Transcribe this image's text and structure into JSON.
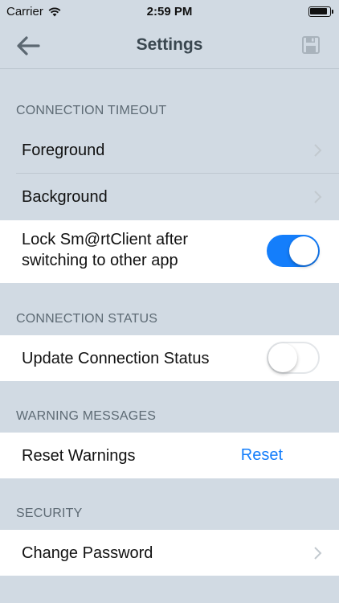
{
  "status_bar": {
    "carrier": "Carrier",
    "time": "2:59 PM"
  },
  "nav": {
    "title": "Settings",
    "back_icon": "arrow-left-icon",
    "save_icon": "floppy-disk-icon"
  },
  "sections": {
    "timeout": {
      "header": "CONNECTION TIMEOUT",
      "foreground": "Foreground",
      "background": "Background",
      "lock_line1": "Lock Sm@rtClient after",
      "lock_line2": "switching to other app",
      "lock_toggle_on": true
    },
    "status": {
      "header": "CONNECTION STATUS",
      "update": "Update Connection Status",
      "update_toggle_on": false
    },
    "warnings": {
      "header": "WARNING MESSAGES",
      "reset_label": "Reset Warnings",
      "reset_action": "Reset"
    },
    "security": {
      "header": "SECURITY",
      "change_password": "Change Password"
    }
  },
  "colors": {
    "background": "#d1dae3",
    "accent": "#147efb",
    "header_text": "#5d6a74",
    "title_text": "#3a4750"
  }
}
